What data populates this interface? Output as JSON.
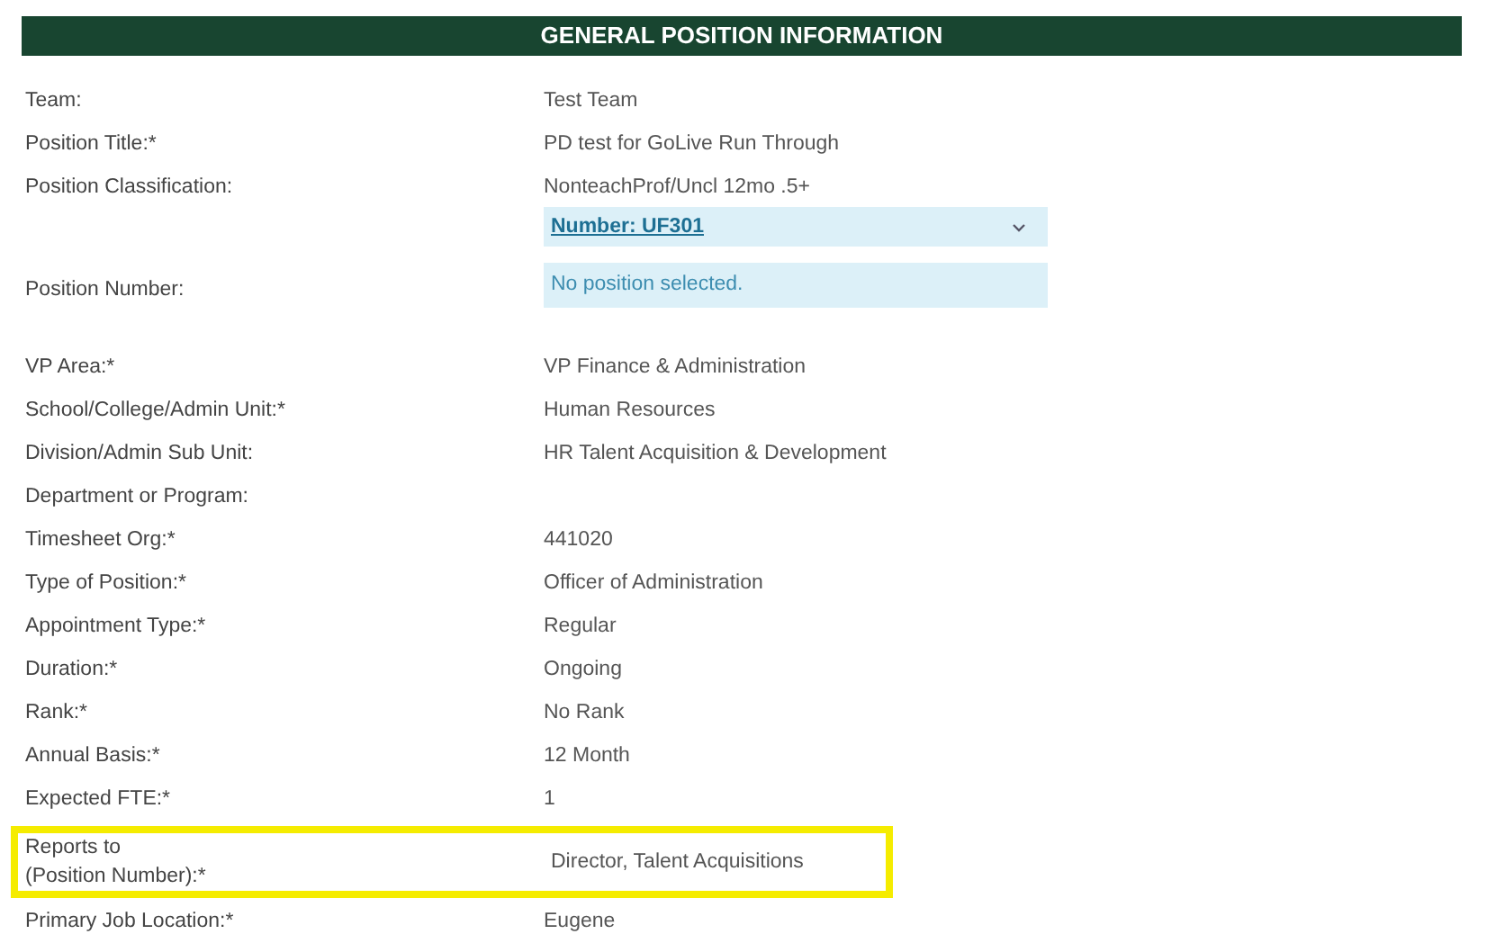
{
  "header": {
    "title": "GENERAL POSITION INFORMATION"
  },
  "rows": [
    {
      "kind": "text",
      "label": "Team:",
      "value": "Test Team",
      "highlighted": false
    },
    {
      "kind": "text",
      "label": "Position Title:*",
      "value": "PD test for GoLive Run Through",
      "highlighted": false
    },
    {
      "kind": "dropdown",
      "label": "Position Classification:",
      "value": "NonteachProf/Uncl 12mo .5+",
      "dropdown": "Number: UF301",
      "highlighted": false
    },
    {
      "kind": "box",
      "label": "Position Number:",
      "value": "No position selected.",
      "highlighted": false
    },
    {
      "kind": "text",
      "label": "VP Area:*",
      "value": "VP Finance & Administration",
      "highlighted": false
    },
    {
      "kind": "text",
      "label": "School/College/Admin Unit:*",
      "value": "Human Resources",
      "highlighted": false
    },
    {
      "kind": "text",
      "label": "Division/Admin Sub Unit:",
      "value": "HR Talent Acquisition & Development",
      "highlighted": false
    },
    {
      "kind": "text",
      "label": "Department or Program:",
      "highlighted": false
    },
    {
      "kind": "text",
      "label": "Timesheet Org:*",
      "value": "441020",
      "highlighted": false
    },
    {
      "kind": "text",
      "label": "Type of Position:*",
      "value": "Officer of Administration",
      "highlighted": false
    },
    {
      "kind": "text",
      "label": "Appointment Type:*",
      "value": "Regular",
      "highlighted": false
    },
    {
      "kind": "text",
      "label": "Duration:*",
      "value": "Ongoing",
      "highlighted": false
    },
    {
      "kind": "text",
      "label": "Rank:*",
      "value": "No Rank",
      "highlighted": false
    },
    {
      "kind": "text",
      "label": "Annual Basis:*",
      "value": "12 Month",
      "highlighted": false
    },
    {
      "kind": "text",
      "label": "Expected FTE:*",
      "value": "1",
      "highlighted": false
    },
    {
      "kind": "text",
      "label": "Reports to\n(Position Number):*",
      "value": "Director, Talent Acquisitions",
      "highlighted": true
    },
    {
      "kind": "text",
      "label": "Primary Job Location:*",
      "value": "Eugene",
      "highlighted": false
    }
  ]
}
